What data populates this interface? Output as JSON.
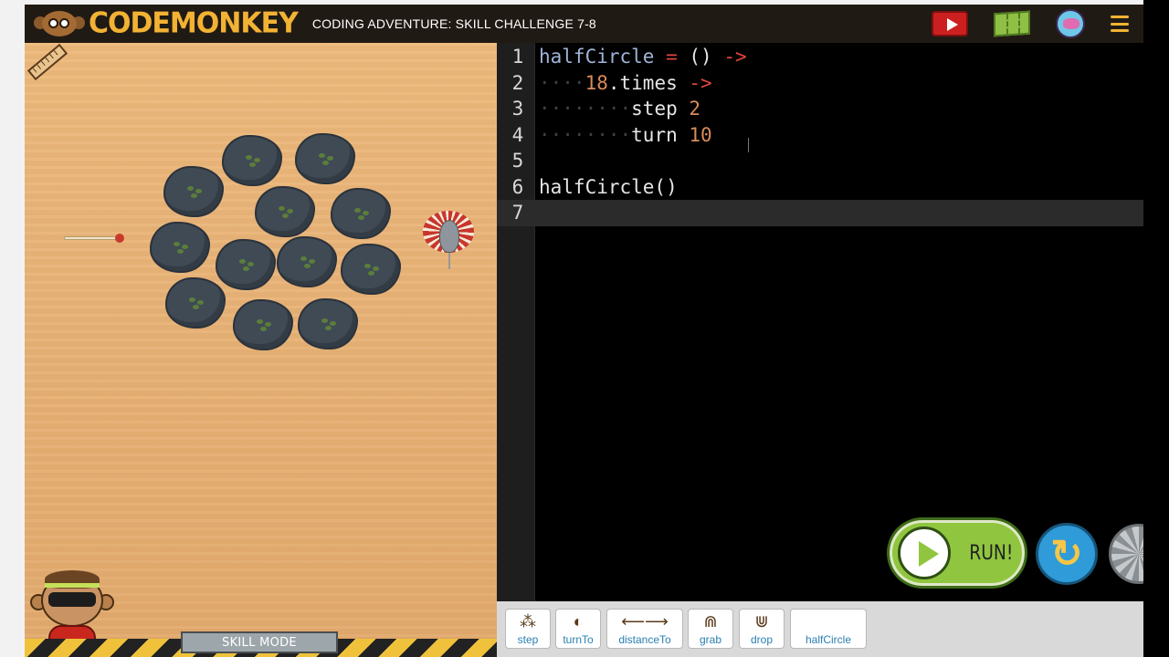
{
  "header": {
    "logo_text": "CODEMONKEY",
    "level_title": "CODING ADVENTURE: SKILL CHALLENGE 7-8",
    "icons": [
      "youtube-play-icon",
      "map-icon",
      "avatar-icon",
      "menu-icon"
    ]
  },
  "board": {
    "mode_badge": "SKILL MODE"
  },
  "editor": {
    "lines": [
      {
        "n": "1",
        "parts": [
          {
            "t": "halfCircle",
            "c": "fn"
          },
          {
            "t": " = ",
            "c": "op"
          },
          {
            "t": "() ",
            "c": "plain"
          },
          {
            "t": "->",
            "c": "op"
          }
        ]
      },
      {
        "n": "2",
        "parts": [
          {
            "t": "····",
            "c": "dot"
          },
          {
            "t": "18",
            "c": "num"
          },
          {
            "t": ".times ",
            "c": "plain"
          },
          {
            "t": "->",
            "c": "op"
          }
        ]
      },
      {
        "n": "3",
        "parts": [
          {
            "t": "········",
            "c": "dot"
          },
          {
            "t": "step ",
            "c": "plain"
          },
          {
            "t": "2",
            "c": "num"
          }
        ]
      },
      {
        "n": "4",
        "parts": [
          {
            "t": "········",
            "c": "dot"
          },
          {
            "t": "turn ",
            "c": "plain"
          },
          {
            "t": "10",
            "c": "num"
          }
        ]
      },
      {
        "n": "5",
        "parts": []
      },
      {
        "n": "6",
        "parts": [
          {
            "t": "halfCircle()",
            "c": "plain"
          }
        ]
      },
      {
        "n": "7",
        "parts": []
      }
    ],
    "active_line": 7
  },
  "controls": {
    "run_label": "RUN!"
  },
  "toolbar": {
    "tools": [
      {
        "id": "step",
        "label": "step",
        "icon": "footprints-icon"
      },
      {
        "id": "turnTo",
        "label": "turnTo",
        "icon": "turn-to-icon"
      },
      {
        "id": "distanceTo",
        "label": "distanceTo",
        "icon": "distance-arrow-icon"
      },
      {
        "id": "grab",
        "label": "grab",
        "icon": "grab-claw-icon"
      },
      {
        "id": "drop",
        "label": "drop",
        "icon": "drop-claw-icon"
      },
      {
        "id": "halfCircle",
        "label": "halfCircle",
        "icon": ""
      }
    ]
  },
  "colors": {
    "accent_gold": "#f2b233",
    "run_green": "#90c63f",
    "reset_blue": "#2f9bd9",
    "keyword_red": "#e0463a",
    "number_orange": "#d88b5a",
    "function_blue": "#9fb4d8"
  }
}
